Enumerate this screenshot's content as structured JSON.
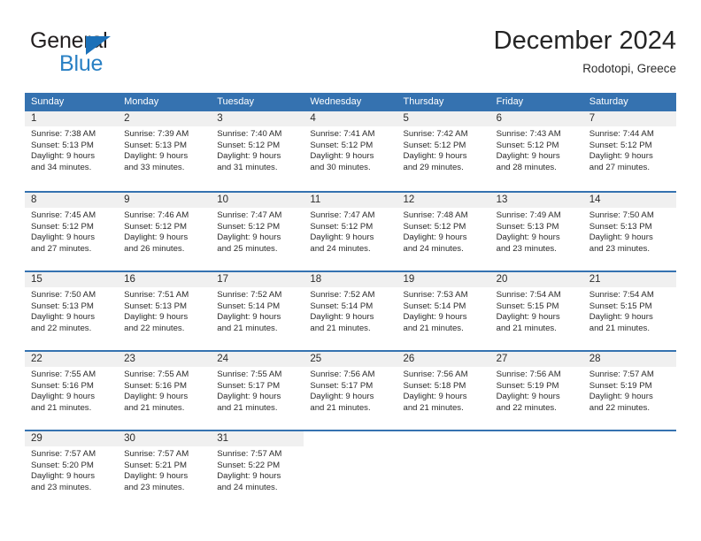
{
  "brand": {
    "name_part1": "General",
    "name_part2": "Blue",
    "triangle_color": "#1b70b8",
    "blue_color": "#2980c4"
  },
  "header": {
    "title": "December 2024",
    "location": "Rodotopi, Greece"
  },
  "theme": {
    "header_blue": "#3572b0",
    "day_band_gray": "#f0f0f0",
    "text_color": "#2b2b2b"
  },
  "calendar": {
    "weekday_headers": [
      "Sunday",
      "Monday",
      "Tuesday",
      "Wednesday",
      "Thursday",
      "Friday",
      "Saturday"
    ],
    "weeks": [
      [
        {
          "day": "1",
          "sunrise": "Sunrise: 7:38 AM",
          "sunset": "Sunset: 5:13 PM",
          "daylight1": "Daylight: 9 hours",
          "daylight2": "and 34 minutes."
        },
        {
          "day": "2",
          "sunrise": "Sunrise: 7:39 AM",
          "sunset": "Sunset: 5:13 PM",
          "daylight1": "Daylight: 9 hours",
          "daylight2": "and 33 minutes."
        },
        {
          "day": "3",
          "sunrise": "Sunrise: 7:40 AM",
          "sunset": "Sunset: 5:12 PM",
          "daylight1": "Daylight: 9 hours",
          "daylight2": "and 31 minutes."
        },
        {
          "day": "4",
          "sunrise": "Sunrise: 7:41 AM",
          "sunset": "Sunset: 5:12 PM",
          "daylight1": "Daylight: 9 hours",
          "daylight2": "and 30 minutes."
        },
        {
          "day": "5",
          "sunrise": "Sunrise: 7:42 AM",
          "sunset": "Sunset: 5:12 PM",
          "daylight1": "Daylight: 9 hours",
          "daylight2": "and 29 minutes."
        },
        {
          "day": "6",
          "sunrise": "Sunrise: 7:43 AM",
          "sunset": "Sunset: 5:12 PM",
          "daylight1": "Daylight: 9 hours",
          "daylight2": "and 28 minutes."
        },
        {
          "day": "7",
          "sunrise": "Sunrise: 7:44 AM",
          "sunset": "Sunset: 5:12 PM",
          "daylight1": "Daylight: 9 hours",
          "daylight2": "and 27 minutes."
        }
      ],
      [
        {
          "day": "8",
          "sunrise": "Sunrise: 7:45 AM",
          "sunset": "Sunset: 5:12 PM",
          "daylight1": "Daylight: 9 hours",
          "daylight2": "and 27 minutes."
        },
        {
          "day": "9",
          "sunrise": "Sunrise: 7:46 AM",
          "sunset": "Sunset: 5:12 PM",
          "daylight1": "Daylight: 9 hours",
          "daylight2": "and 26 minutes."
        },
        {
          "day": "10",
          "sunrise": "Sunrise: 7:47 AM",
          "sunset": "Sunset: 5:12 PM",
          "daylight1": "Daylight: 9 hours",
          "daylight2": "and 25 minutes."
        },
        {
          "day": "11",
          "sunrise": "Sunrise: 7:47 AM",
          "sunset": "Sunset: 5:12 PM",
          "daylight1": "Daylight: 9 hours",
          "daylight2": "and 24 minutes."
        },
        {
          "day": "12",
          "sunrise": "Sunrise: 7:48 AM",
          "sunset": "Sunset: 5:12 PM",
          "daylight1": "Daylight: 9 hours",
          "daylight2": "and 24 minutes."
        },
        {
          "day": "13",
          "sunrise": "Sunrise: 7:49 AM",
          "sunset": "Sunset: 5:13 PM",
          "daylight1": "Daylight: 9 hours",
          "daylight2": "and 23 minutes."
        },
        {
          "day": "14",
          "sunrise": "Sunrise: 7:50 AM",
          "sunset": "Sunset: 5:13 PM",
          "daylight1": "Daylight: 9 hours",
          "daylight2": "and 23 minutes."
        }
      ],
      [
        {
          "day": "15",
          "sunrise": "Sunrise: 7:50 AM",
          "sunset": "Sunset: 5:13 PM",
          "daylight1": "Daylight: 9 hours",
          "daylight2": "and 22 minutes."
        },
        {
          "day": "16",
          "sunrise": "Sunrise: 7:51 AM",
          "sunset": "Sunset: 5:13 PM",
          "daylight1": "Daylight: 9 hours",
          "daylight2": "and 22 minutes."
        },
        {
          "day": "17",
          "sunrise": "Sunrise: 7:52 AM",
          "sunset": "Sunset: 5:14 PM",
          "daylight1": "Daylight: 9 hours",
          "daylight2": "and 21 minutes."
        },
        {
          "day": "18",
          "sunrise": "Sunrise: 7:52 AM",
          "sunset": "Sunset: 5:14 PM",
          "daylight1": "Daylight: 9 hours",
          "daylight2": "and 21 minutes."
        },
        {
          "day": "19",
          "sunrise": "Sunrise: 7:53 AM",
          "sunset": "Sunset: 5:14 PM",
          "daylight1": "Daylight: 9 hours",
          "daylight2": "and 21 minutes."
        },
        {
          "day": "20",
          "sunrise": "Sunrise: 7:54 AM",
          "sunset": "Sunset: 5:15 PM",
          "daylight1": "Daylight: 9 hours",
          "daylight2": "and 21 minutes."
        },
        {
          "day": "21",
          "sunrise": "Sunrise: 7:54 AM",
          "sunset": "Sunset: 5:15 PM",
          "daylight1": "Daylight: 9 hours",
          "daylight2": "and 21 minutes."
        }
      ],
      [
        {
          "day": "22",
          "sunrise": "Sunrise: 7:55 AM",
          "sunset": "Sunset: 5:16 PM",
          "daylight1": "Daylight: 9 hours",
          "daylight2": "and 21 minutes."
        },
        {
          "day": "23",
          "sunrise": "Sunrise: 7:55 AM",
          "sunset": "Sunset: 5:16 PM",
          "daylight1": "Daylight: 9 hours",
          "daylight2": "and 21 minutes."
        },
        {
          "day": "24",
          "sunrise": "Sunrise: 7:55 AM",
          "sunset": "Sunset: 5:17 PM",
          "daylight1": "Daylight: 9 hours",
          "daylight2": "and 21 minutes."
        },
        {
          "day": "25",
          "sunrise": "Sunrise: 7:56 AM",
          "sunset": "Sunset: 5:17 PM",
          "daylight1": "Daylight: 9 hours",
          "daylight2": "and 21 minutes."
        },
        {
          "day": "26",
          "sunrise": "Sunrise: 7:56 AM",
          "sunset": "Sunset: 5:18 PM",
          "daylight1": "Daylight: 9 hours",
          "daylight2": "and 21 minutes."
        },
        {
          "day": "27",
          "sunrise": "Sunrise: 7:56 AM",
          "sunset": "Sunset: 5:19 PM",
          "daylight1": "Daylight: 9 hours",
          "daylight2": "and 22 minutes."
        },
        {
          "day": "28",
          "sunrise": "Sunrise: 7:57 AM",
          "sunset": "Sunset: 5:19 PM",
          "daylight1": "Daylight: 9 hours",
          "daylight2": "and 22 minutes."
        }
      ],
      [
        {
          "day": "29",
          "sunrise": "Sunrise: 7:57 AM",
          "sunset": "Sunset: 5:20 PM",
          "daylight1": "Daylight: 9 hours",
          "daylight2": "and 23 minutes."
        },
        {
          "day": "30",
          "sunrise": "Sunrise: 7:57 AM",
          "sunset": "Sunset: 5:21 PM",
          "daylight1": "Daylight: 9 hours",
          "daylight2": "and 23 minutes."
        },
        {
          "day": "31",
          "sunrise": "Sunrise: 7:57 AM",
          "sunset": "Sunset: 5:22 PM",
          "daylight1": "Daylight: 9 hours",
          "daylight2": "and 24 minutes."
        },
        {
          "day": "",
          "sunrise": "",
          "sunset": "",
          "daylight1": "",
          "daylight2": ""
        },
        {
          "day": "",
          "sunrise": "",
          "sunset": "",
          "daylight1": "",
          "daylight2": ""
        },
        {
          "day": "",
          "sunrise": "",
          "sunset": "",
          "daylight1": "",
          "daylight2": ""
        },
        {
          "day": "",
          "sunrise": "",
          "sunset": "",
          "daylight1": "",
          "daylight2": ""
        }
      ]
    ]
  }
}
